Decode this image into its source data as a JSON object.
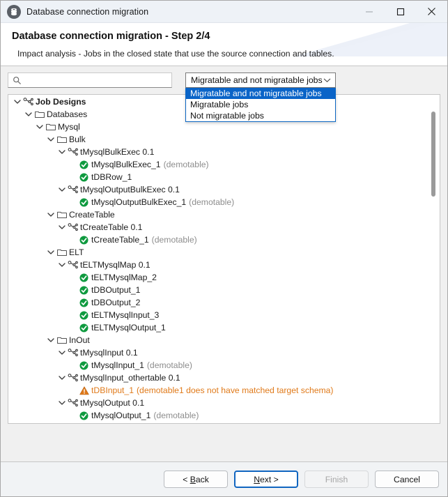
{
  "window": {
    "title": "Database connection migration",
    "icon": "database-icon",
    "controls": {
      "minimize": "minimize-icon",
      "maximize": "maximize-icon",
      "close": "close-icon"
    }
  },
  "banner": {
    "title": "Database connection migration - Step 2/4",
    "subtitle": "Impact analysis - Jobs in the closed state that use the source connection and tables."
  },
  "search": {
    "value": "",
    "placeholder": "",
    "icon": "search-icon"
  },
  "filter_combo": {
    "selected": "Migratable and not migratable jobs",
    "expanded": true,
    "arrow_icon": "chevron-down-icon",
    "options": [
      "Migratable and not migratable jobs",
      "Migratable jobs",
      "Not migratable jobs"
    ],
    "highlight_color": "#0a64c8"
  },
  "tree": {
    "scrollbar": {
      "thumb_top_pct": 5,
      "thumb_height_pct": 26
    },
    "rows": [
      {
        "depth": 0,
        "icon": "job-designs-icon",
        "twisty": "expanded",
        "label": "Job Designs",
        "bold": true,
        "note": ""
      },
      {
        "depth": 1,
        "icon": "folder-icon",
        "twisty": "expanded",
        "label": "Databases",
        "bold": false,
        "note": ""
      },
      {
        "depth": 2,
        "icon": "folder-icon",
        "twisty": "expanded",
        "label": "Mysql",
        "bold": false,
        "note": ""
      },
      {
        "depth": 3,
        "icon": "folder-icon",
        "twisty": "expanded",
        "label": "Bulk",
        "bold": false,
        "note": ""
      },
      {
        "depth": 4,
        "icon": "job-icon",
        "twisty": "expanded",
        "label": "tMysqlBulkExec 0.1",
        "bold": false,
        "note": ""
      },
      {
        "depth": 5,
        "icon": "status-ok-icon",
        "twisty": "none",
        "label": "tMysqlBulkExec_1",
        "bold": false,
        "note": "(demotable)"
      },
      {
        "depth": 5,
        "icon": "status-ok-icon",
        "twisty": "none",
        "label": "tDBRow_1",
        "bold": false,
        "note": ""
      },
      {
        "depth": 4,
        "icon": "job-icon",
        "twisty": "expanded",
        "label": "tMysqlOutputBulkExec 0.1",
        "bold": false,
        "note": ""
      },
      {
        "depth": 5,
        "icon": "status-ok-icon",
        "twisty": "none",
        "label": "tMysqlOutputBulkExec_1",
        "bold": false,
        "note": "(demotable)"
      },
      {
        "depth": 3,
        "icon": "folder-icon",
        "twisty": "expanded",
        "label": "CreateTable",
        "bold": false,
        "note": ""
      },
      {
        "depth": 4,
        "icon": "job-icon",
        "twisty": "expanded",
        "label": "tCreateTable 0.1",
        "bold": false,
        "note": ""
      },
      {
        "depth": 5,
        "icon": "status-ok-icon",
        "twisty": "none",
        "label": "tCreateTable_1",
        "bold": false,
        "note": "(demotable)"
      },
      {
        "depth": 3,
        "icon": "folder-icon",
        "twisty": "expanded",
        "label": "ELT",
        "bold": false,
        "note": ""
      },
      {
        "depth": 4,
        "icon": "job-icon",
        "twisty": "expanded",
        "label": "tELTMysqlMap 0.1",
        "bold": false,
        "note": ""
      },
      {
        "depth": 5,
        "icon": "status-ok-icon",
        "twisty": "none",
        "label": "tELTMysqlMap_2",
        "bold": false,
        "note": ""
      },
      {
        "depth": 5,
        "icon": "status-ok-icon",
        "twisty": "none",
        "label": "tDBOutput_1",
        "bold": false,
        "note": ""
      },
      {
        "depth": 5,
        "icon": "status-ok-icon",
        "twisty": "none",
        "label": "tDBOutput_2",
        "bold": false,
        "note": ""
      },
      {
        "depth": 5,
        "icon": "status-ok-icon",
        "twisty": "none",
        "label": "tELTMysqlInput_3",
        "bold": false,
        "note": ""
      },
      {
        "depth": 5,
        "icon": "status-ok-icon",
        "twisty": "none",
        "label": "tELTMysqlOutput_1",
        "bold": false,
        "note": ""
      },
      {
        "depth": 3,
        "icon": "folder-icon",
        "twisty": "expanded",
        "label": "InOut",
        "bold": false,
        "note": ""
      },
      {
        "depth": 4,
        "icon": "job-icon",
        "twisty": "expanded",
        "label": "tMysqlInput 0.1",
        "bold": false,
        "note": ""
      },
      {
        "depth": 5,
        "icon": "status-ok-icon",
        "twisty": "none",
        "label": "tMysqlInput_1",
        "bold": false,
        "note": "(demotable)"
      },
      {
        "depth": 4,
        "icon": "job-icon",
        "twisty": "expanded",
        "label": "tMysqlInput_othertable 0.1",
        "bold": false,
        "note": ""
      },
      {
        "depth": 5,
        "icon": "status-warning-icon",
        "twisty": "none",
        "label": "tDBInput_1",
        "bold": false,
        "note": "(demotable1 does not have matched target schema)",
        "warn": true
      },
      {
        "depth": 4,
        "icon": "job-icon",
        "twisty": "expanded",
        "label": "tMysqlOutput 0.1",
        "bold": false,
        "note": ""
      },
      {
        "depth": 5,
        "icon": "status-ok-icon",
        "twisty": "none",
        "label": "tMysqlOutput_1",
        "bold": false,
        "note": "(demotable)"
      }
    ]
  },
  "footer": {
    "back": {
      "prefix": "< ",
      "accel": "B",
      "rest": "ack"
    },
    "next": {
      "prefix": "",
      "accel": "N",
      "rest": "ext >"
    },
    "finish": {
      "label": "Finish",
      "disabled": true
    },
    "cancel": {
      "label": "Cancel"
    }
  },
  "colors": {
    "accent": "#1065c0",
    "ok": "#0f9a3f",
    "warning": "#e07a1a",
    "note": "#8d8d8d"
  }
}
